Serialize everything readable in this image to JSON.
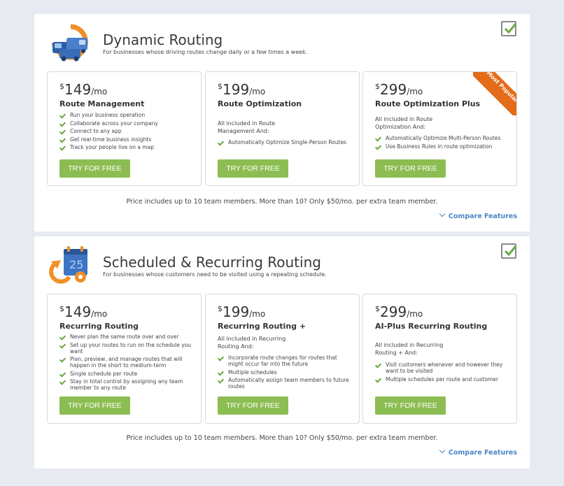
{
  "colors": {
    "button_green": "#8cbd52",
    "check_green": "#6da843",
    "ribbon_orange": "#e46b17",
    "link_blue": "#4a86c5",
    "page_bg": "#e7ebf1"
  },
  "sections": [
    {
      "title": "Dynamic Routing",
      "subtitle": "For businesses whose driving routes change daily or a few times a week.",
      "icon": "vans-route-icon",
      "checked": true,
      "plans": [
        {
          "currency": "$",
          "amount": "149",
          "period": "/mo",
          "name": "Route Management",
          "included_text": "",
          "features": [
            "Run your business operation",
            "Collaborate across your company",
            "Connect to any app",
            "Get real-time business insights",
            "Track your people live on a map"
          ],
          "button": "TRY FOR FREE"
        },
        {
          "currency": "$",
          "amount": "199",
          "period": "/mo",
          "name": "Route Optimization",
          "included_text": "All included in Route Management And:",
          "features": [
            "Automatically Optimize Single-Person Routes"
          ],
          "button": "TRY FOR FREE"
        },
        {
          "currency": "$",
          "amount": "299",
          "period": "/mo",
          "name": "Route Optimization Plus",
          "included_text": "All included in Route Optimization And:",
          "features": [
            "Automatically Optimize Multi-Person Routes",
            "Use Business Rules in route optimization"
          ],
          "button": "TRY FOR FREE",
          "ribbon": "Most Popular"
        }
      ],
      "note": "Price includes up to 10 team members. More than 10? Only $50/mo. per extra team member.",
      "compare": "Compare Features"
    },
    {
      "title": "Scheduled & Recurring Routing",
      "subtitle": "For businesses whose customers need to be visited using a repeating schedule.",
      "icon": "calendar-recurring-icon",
      "checked": true,
      "plans": [
        {
          "currency": "$",
          "amount": "149",
          "period": "/mo",
          "name": "Recurring Routing",
          "included_text": "",
          "features": [
            "Never plan the same route over and over",
            "Set up your routes to run on the schedule you want",
            "Plan, preview, and manage routes that will happen in the short to medium-term",
            "Single schedule per route",
            "Stay in total control by assigning any team member to any route"
          ],
          "button": "TRY FOR FREE"
        },
        {
          "currency": "$",
          "amount": "199",
          "period": "/mo",
          "name": "Recurring Routing +",
          "included_text": "All included in Recurring Routing And:",
          "features": [
            "Incorporate route changes for routes that might occur far into the future",
            "Multiple schedules",
            "Automatically assign team members to future routes"
          ],
          "button": "TRY FOR FREE"
        },
        {
          "currency": "$",
          "amount": "299",
          "period": "/mo",
          "name": "AI-Plus Recurring Routing",
          "included_text": "All included in Recurring Routing + And:",
          "features": [
            "Visit customers whenever and however they want to be visited",
            "Multiple schedules per route and customer"
          ],
          "button": "TRY FOR FREE"
        }
      ],
      "note": "Price includes up to 10 team members. More than 10? Only $50/mo. per extra team member.",
      "compare": "Compare Features"
    }
  ]
}
